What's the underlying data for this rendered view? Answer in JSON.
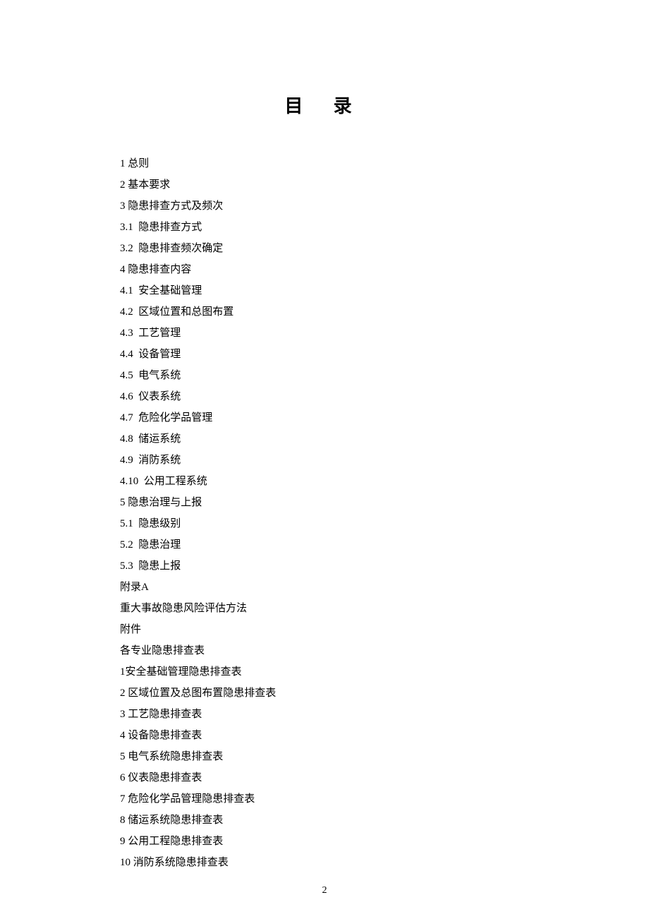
{
  "title": "目  录",
  "toc_entries": [
    "1 总则",
    "2 基本要求",
    "3 隐患排查方式及频次",
    "3.1  隐患排查方式",
    "3.2  隐患排查频次确定",
    "4 隐患排查内容",
    "4.1  安全基础管理",
    "4.2  区域位置和总图布置",
    "4.3  工艺管理",
    "4.4  设备管理",
    "4.5  电气系统",
    "4.6  仪表系统",
    "4.7  危险化学品管理",
    "4.8  储运系统",
    "4.9  消防系统",
    "4.10  公用工程系统",
    "5 隐患治理与上报",
    "5.1  隐患级别",
    "5.2  隐患治理",
    "5.3  隐患上报",
    "附录A",
    "重大事故隐患风险评估方法",
    "附件",
    "各专业隐患排查表",
    "1安全基础管理隐患排查表",
    "2 区域位置及总图布置隐患排查表",
    "3 工艺隐患排查表",
    "4 设备隐患排查表",
    "5 电气系统隐患排查表",
    "6 仪表隐患排查表",
    "7 危险化学品管理隐患排查表",
    "8 储运系统隐患排查表",
    "9 公用工程隐患排查表",
    "10 消防系统隐患排查表"
  ],
  "page_number": "2"
}
